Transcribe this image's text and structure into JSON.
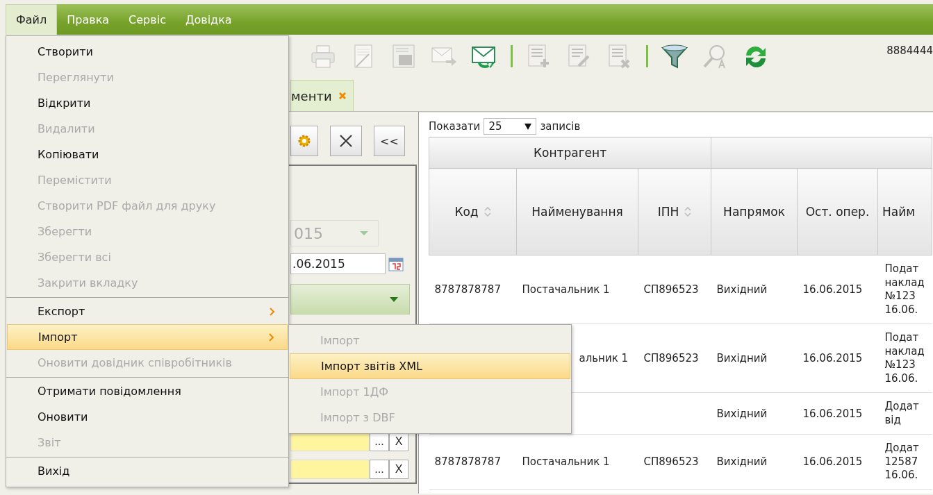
{
  "menubar": [
    {
      "label": "Файл",
      "selected": true
    },
    {
      "label": "Правка",
      "selected": false
    },
    {
      "label": "Сервіс",
      "selected": false
    },
    {
      "label": "Довідка",
      "selected": false
    }
  ],
  "file_menu": [
    {
      "kind": "item",
      "label": "Створити",
      "disabled": false,
      "selected": false,
      "submenu": false
    },
    {
      "kind": "item",
      "label": "Переглянути",
      "disabled": true,
      "selected": false,
      "submenu": false
    },
    {
      "kind": "item",
      "label": "Відкрити",
      "disabled": false,
      "selected": false,
      "submenu": false
    },
    {
      "kind": "item",
      "label": "Видалити",
      "disabled": true,
      "selected": false,
      "submenu": false
    },
    {
      "kind": "item",
      "label": "Копіювати",
      "disabled": false,
      "selected": false,
      "submenu": false
    },
    {
      "kind": "item",
      "label": "Перемістити",
      "disabled": true,
      "selected": false,
      "submenu": false
    },
    {
      "kind": "item",
      "label": "Створити PDF файл для друку",
      "disabled": true,
      "selected": false,
      "submenu": false
    },
    {
      "kind": "item",
      "label": "Зберегти",
      "disabled": true,
      "selected": false,
      "submenu": false
    },
    {
      "kind": "item",
      "label": "Зберегти всі",
      "disabled": true,
      "selected": false,
      "submenu": false
    },
    {
      "kind": "item",
      "label": "Закрити вкладку",
      "disabled": true,
      "selected": false,
      "submenu": false
    },
    {
      "kind": "separator"
    },
    {
      "kind": "item",
      "label": "Експорт",
      "disabled": false,
      "selected": false,
      "submenu": true
    },
    {
      "kind": "item",
      "label": "Імпорт",
      "disabled": false,
      "selected": true,
      "submenu": true
    },
    {
      "kind": "item",
      "label": "Оновити довідник співробітників",
      "disabled": true,
      "selected": false,
      "submenu": false
    },
    {
      "kind": "separator"
    },
    {
      "kind": "item",
      "label": "Отримати повідомлення",
      "disabled": false,
      "selected": false,
      "submenu": false
    },
    {
      "kind": "item",
      "label": "Оновити",
      "disabled": false,
      "selected": false,
      "submenu": false
    },
    {
      "kind": "item",
      "label": "Звіт",
      "disabled": true,
      "selected": false,
      "submenu": false
    },
    {
      "kind": "separator"
    },
    {
      "kind": "item",
      "label": "Вихід",
      "disabled": false,
      "selected": false,
      "submenu": false
    }
  ],
  "import_submenu": [
    {
      "kind": "item",
      "label": "Імпорт",
      "disabled": true,
      "selected": false,
      "submenu": false
    },
    {
      "kind": "item",
      "label": "Імпорт звітів XML",
      "disabled": false,
      "selected": true,
      "submenu": false
    },
    {
      "kind": "item",
      "label": "Імпорт 1ДФ",
      "disabled": true,
      "selected": false,
      "submenu": false
    },
    {
      "kind": "item",
      "label": "Імпорт з DBF",
      "disabled": true,
      "selected": false,
      "submenu": false
    }
  ],
  "toolbar": {
    "tools": [
      {
        "kind": "printer",
        "disabled": true
      },
      {
        "kind": "pen",
        "disabled": true
      },
      {
        "kind": "calculator",
        "disabled": true
      },
      {
        "kind": "mail-send",
        "disabled": true
      },
      {
        "kind": "mail-receive",
        "disabled": false
      },
      {
        "kind": "separator"
      },
      {
        "kind": "doc-add",
        "disabled": true
      },
      {
        "kind": "doc-edit",
        "disabled": true
      },
      {
        "kind": "doc-delete",
        "disabled": true
      },
      {
        "kind": "separator"
      },
      {
        "kind": "filter",
        "disabled": false
      },
      {
        "kind": "find",
        "disabled": true
      },
      {
        "kind": "refresh",
        "disabled": false
      }
    ],
    "account": "8884444"
  },
  "tabs": [
    {
      "label": "менти",
      "selected": true
    }
  ],
  "side_panel": {
    "more_button": "<<",
    "year_combo": {
      "value": "015",
      "disabled": true
    },
    "date_field": {
      "value": ".06.2015"
    },
    "lookups": [
      {
        "browse": "...",
        "clear": "X"
      },
      {
        "browse": "...",
        "clear": "X"
      }
    ]
  },
  "table": {
    "show_label": "Показати",
    "page_size": "25",
    "records_label": "записів",
    "groups": [
      {
        "label": "Контрагент"
      }
    ],
    "columns": [
      {
        "label": "Код",
        "sortable": true
      },
      {
        "label": "Найменування",
        "sortable": false
      },
      {
        "label": "ІПН",
        "sortable": true
      },
      {
        "label": "Напрямок",
        "sortable": false
      },
      {
        "label": "Ост. опер.",
        "sortable": false
      },
      {
        "label": "Найм",
        "sortable": false
      }
    ],
    "rows": [
      [
        "8787878787",
        "Постачальник 1",
        "СП896523",
        "Вихідний",
        "16.06.2015",
        "Подат наклад №123 16.06."
      ],
      [
        null,
        "альник 1",
        "СП896523",
        "Вихідний",
        "16.06.2015",
        "Подат наклад №123 16.06."
      ],
      [
        null,
        null,
        null,
        "Вихідний",
        "16.06.2015",
        "Додат від"
      ],
      [
        "8787878787",
        "Постачальник 1",
        "СП896523",
        "Вихідний",
        "16.06.2015",
        "Додат 12587 16.06."
      ]
    ]
  }
}
